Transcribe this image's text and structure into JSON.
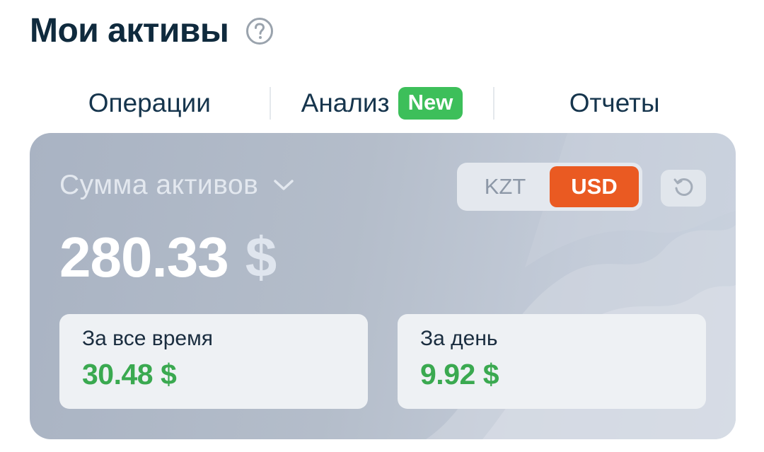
{
  "header": {
    "title": "Мои активы",
    "help_icon": "question-circle-icon"
  },
  "tabs": [
    {
      "label": "Операции"
    },
    {
      "label": "Анализ",
      "badge": "New"
    },
    {
      "label": "Отчеты"
    }
  ],
  "summary": {
    "selector_label": "Сумма активов",
    "selector_icon": "chevron-down-icon",
    "total_amount": "280.33",
    "total_currency": "$",
    "currency_options": [
      "KZT",
      "USD"
    ],
    "selected_currency": "USD",
    "refresh_icon": "refresh-icon",
    "all_time": {
      "label": "За все время",
      "value": "30.48 $"
    },
    "day": {
      "label": "За день",
      "value": "9.92 $"
    }
  },
  "colors": {
    "accent": "#ea5a22",
    "positive": "#3aa950",
    "badge": "#3dbf5a",
    "title": "#0f2a3d"
  }
}
